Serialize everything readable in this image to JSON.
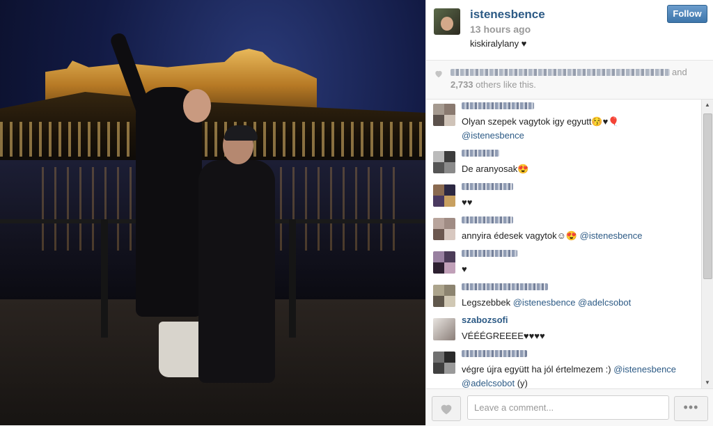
{
  "header": {
    "username": "istenesbence",
    "time": "13 hours ago",
    "caption": "kiskiralylany ♥",
    "follow_label": "Follow"
  },
  "likes": {
    "and_text": "and",
    "count": "2,733",
    "others_text": "others like this."
  },
  "comments": [
    {
      "user": "",
      "text": "Olyan szepek vagytok igy egyutt😚♥🎈",
      "mention_line": "@istenesbence"
    },
    {
      "user": "",
      "text": "De aranyosak😍"
    },
    {
      "user": "",
      "text": "♥♥"
    },
    {
      "user": "",
      "text_before": "annyira édesek vagytok☺😍 ",
      "mention": "@istenesbence"
    },
    {
      "user": "",
      "text": "♥"
    },
    {
      "user": "",
      "text_before": "Legszebbek ",
      "mention": "@istenesbence",
      "mention2": "@adelcsobot"
    },
    {
      "user": "szabozsofi",
      "text": "VÉÉÉGREEEE♥♥♥♥"
    },
    {
      "user": "",
      "text_before": "végre újra együtt ha jól értelmezem :) ",
      "mention": "@istenesbence",
      "mention2": "@adelcsobot",
      "text_after": " (y)"
    }
  ],
  "footer": {
    "comment_placeholder": "Leave a comment...",
    "more_label": "•••"
  },
  "colors": {
    "link": "#2c5a85",
    "follow_bg": "#3e76ab"
  }
}
